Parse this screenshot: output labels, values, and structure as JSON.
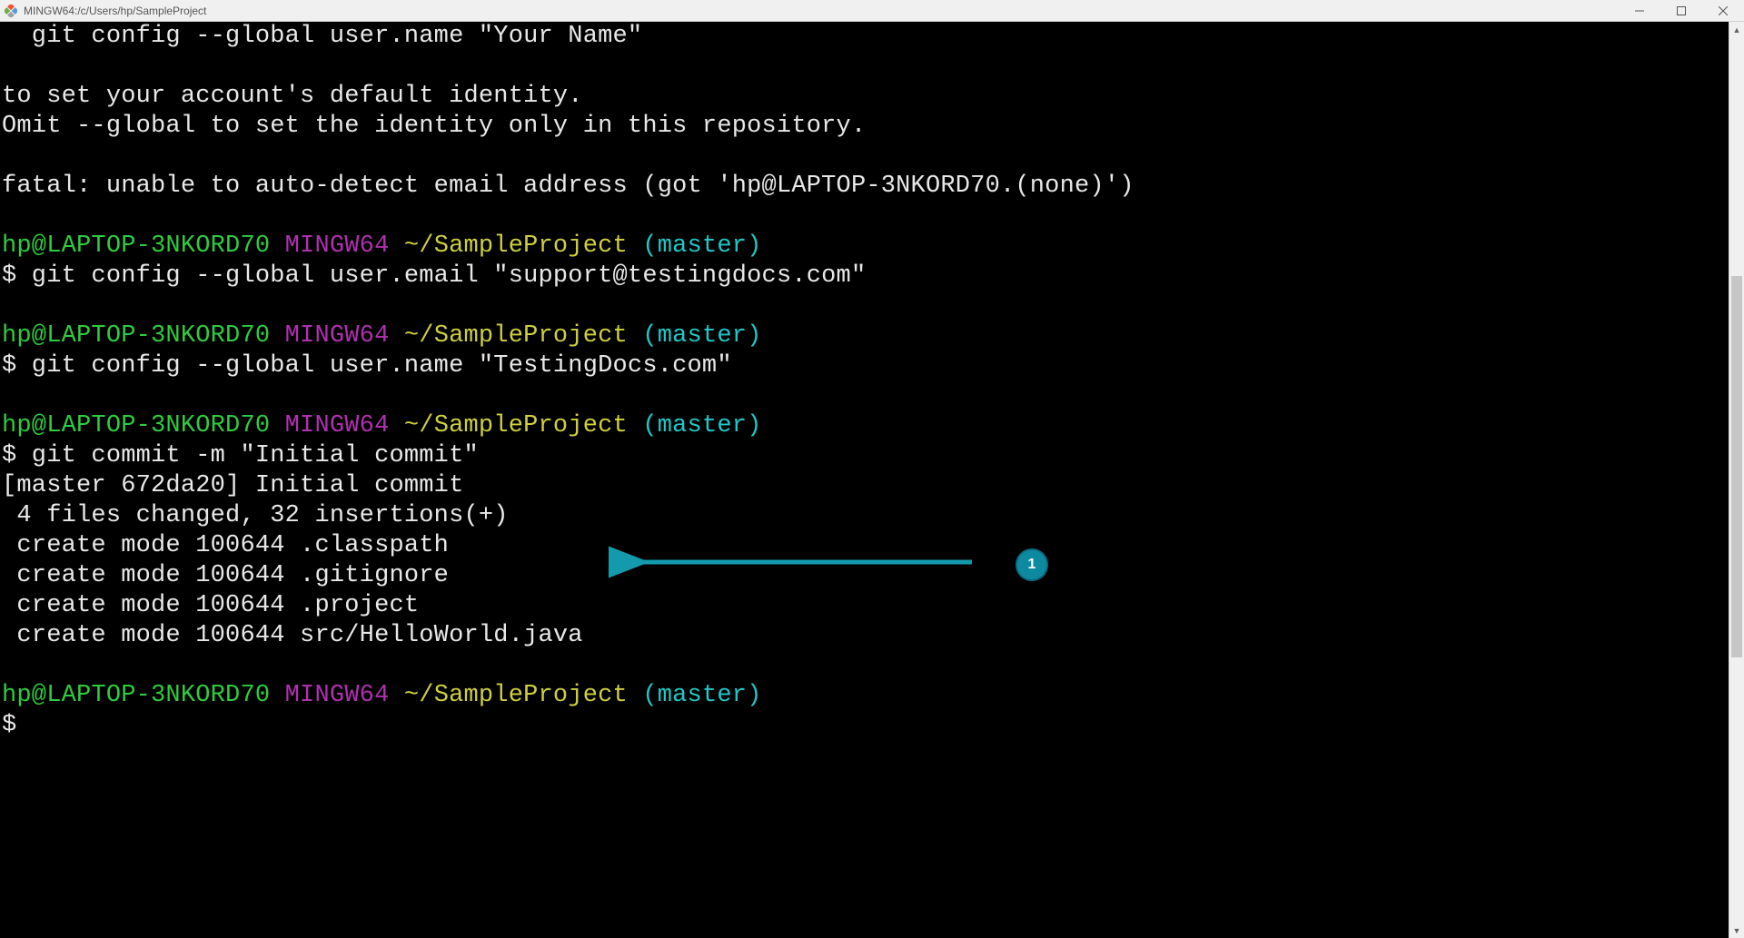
{
  "window": {
    "title": "MINGW64:/c/Users/hp/SampleProject"
  },
  "prompt": {
    "user_host": "hp@LAPTOP-3NKORD70",
    "env": "MINGW64",
    "path": "~/SampleProject",
    "branch": "(master)",
    "symbol": "$"
  },
  "lines": {
    "l1": "  git config --global user.name \"Your Name\"",
    "l2": "",
    "l3": "to set your account's default identity.",
    "l4": "Omit --global to set the identity only in this repository.",
    "l5": "",
    "l6": "fatal: unable to auto-detect email address (got 'hp@LAPTOP-3NKORD70.(none)')",
    "l7": "",
    "cmd1": " git config --global user.email \"support@testingdocs.com\"",
    "l8": "",
    "cmd2": " git config --global user.name \"TestingDocs.com\"",
    "l9": "",
    "cmd3": " git commit -m \"Initial commit\"",
    "r1": "[master 672da20] Initial commit",
    "r2": " 4 files changed, 32 insertions(+)",
    "r3": " create mode 100644 .classpath",
    "r4": " create mode 100644 .gitignore",
    "r5": " create mode 100644 .project",
    "r6": " create mode 100644 src/HelloWorld.java",
    "l10": ""
  },
  "annotation": {
    "number": "1"
  }
}
